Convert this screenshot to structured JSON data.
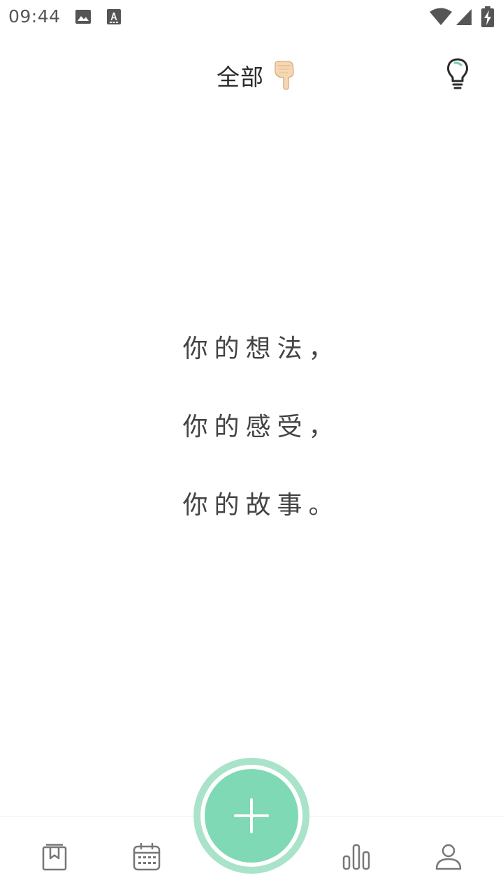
{
  "status_bar": {
    "time": "09:44",
    "icons": [
      "image-icon",
      "font-a-icon",
      "wifi-icon",
      "cell-signal-icon",
      "battery-charging-icon"
    ],
    "icon_color": "#555555"
  },
  "header": {
    "title": "全部",
    "title_icon": "pointing-down-hand-icon",
    "action_icon": "lightbulb-icon"
  },
  "empty_state": {
    "lines": [
      "你的想法，",
      "你的感受，",
      "你的故事。"
    ]
  },
  "bottom_nav": {
    "items": [
      {
        "icon": "diary-bookmark-icon"
      },
      {
        "icon": "calendar-icon"
      },
      {
        "icon": "bar-chart-icon"
      },
      {
        "icon": "person-icon"
      }
    ],
    "fab_icon": "plus-icon"
  },
  "colors": {
    "accent": "#7fd9b5",
    "accent_ring": "#a9e3ca",
    "icon_gray": "#777777",
    "text_dark": "#2b2b2b",
    "bulb_highlight": "#6fcfb0"
  }
}
